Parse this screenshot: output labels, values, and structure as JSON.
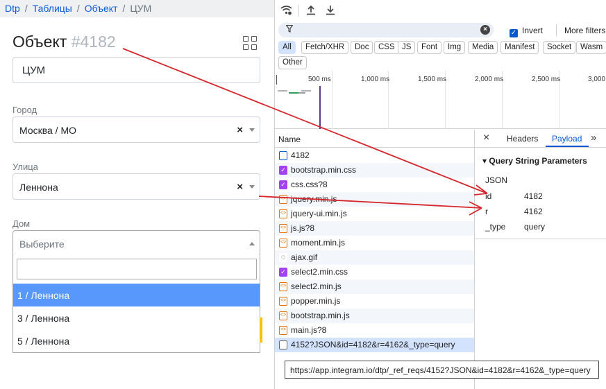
{
  "app": {
    "breadcrumb": [
      {
        "label": "Dtp"
      },
      {
        "label": "Таблицы"
      },
      {
        "label": "Объект"
      },
      {
        "label": "ЦУМ"
      }
    ],
    "title_main": "Объект",
    "title_num": "#4182",
    "name_value": "ЦУМ",
    "city": {
      "label": "Город",
      "value": "Москва / МО",
      "clear": "×"
    },
    "street": {
      "label": "Улица",
      "value": "Леннона",
      "clear": "×"
    },
    "house": {
      "label": "Дом",
      "placeholder": "Выберите"
    },
    "house_options": [
      "1 / Леннона",
      "3 / Леннона",
      "5 / Леннона"
    ],
    "highlighted_option": 0,
    "accent_color": "#5897fb"
  },
  "devtools": {
    "filter": {
      "value": "",
      "invert_label": "Invert",
      "invert_checked": true,
      "more_filters": "More filters"
    },
    "type_chips": [
      "All",
      "Fetch/XHR",
      "Doc",
      "CSS",
      "JS",
      "Font",
      "Img",
      "Media",
      "Manifest",
      "Socket",
      "Wasm",
      "Other"
    ],
    "active_chip": "All",
    "timeline_ticks": [
      "500 ms",
      "1,000 ms",
      "1,500 ms",
      "2,000 ms",
      "2,500 ms",
      "3,000"
    ],
    "list_header": "Name",
    "requests": [
      {
        "name": "4182",
        "type": "doc"
      },
      {
        "name": "bootstrap.min.css",
        "type": "css"
      },
      {
        "name": "css.css?8",
        "type": "css"
      },
      {
        "name": "jquery.min.js",
        "type": "js"
      },
      {
        "name": "jquery-ui.min.js",
        "type": "js"
      },
      {
        "name": "js.js?8",
        "type": "js"
      },
      {
        "name": "moment.min.js",
        "type": "js"
      },
      {
        "name": "ajax.gif",
        "type": "gif"
      },
      {
        "name": "select2.min.css",
        "type": "css"
      },
      {
        "name": "select2.min.js",
        "type": "js"
      },
      {
        "name": "popper.min.js",
        "type": "js"
      },
      {
        "name": "bootstrap.min.js",
        "type": "js"
      },
      {
        "name": "main.js?8",
        "type": "js"
      },
      {
        "name": "4152?JSON&id=4182&r=4162&_type=query",
        "type": "xhr"
      }
    ],
    "selected_request": 13,
    "panel": {
      "tabs": [
        "Headers",
        "Payload"
      ],
      "active_tab": "Payload",
      "section_title": "Query String Parameters",
      "params": [
        {
          "key": "JSON",
          "value": ""
        },
        {
          "key": "id",
          "value": "4182"
        },
        {
          "key": "r",
          "value": "4162"
        },
        {
          "key": "_type",
          "value": "query"
        }
      ]
    },
    "tooltip": "https://app.integram.io/dtp/_ref_reqs/4152?JSON&id=4182&r=4162&_type=query"
  },
  "annotation_color": "#d6262b"
}
